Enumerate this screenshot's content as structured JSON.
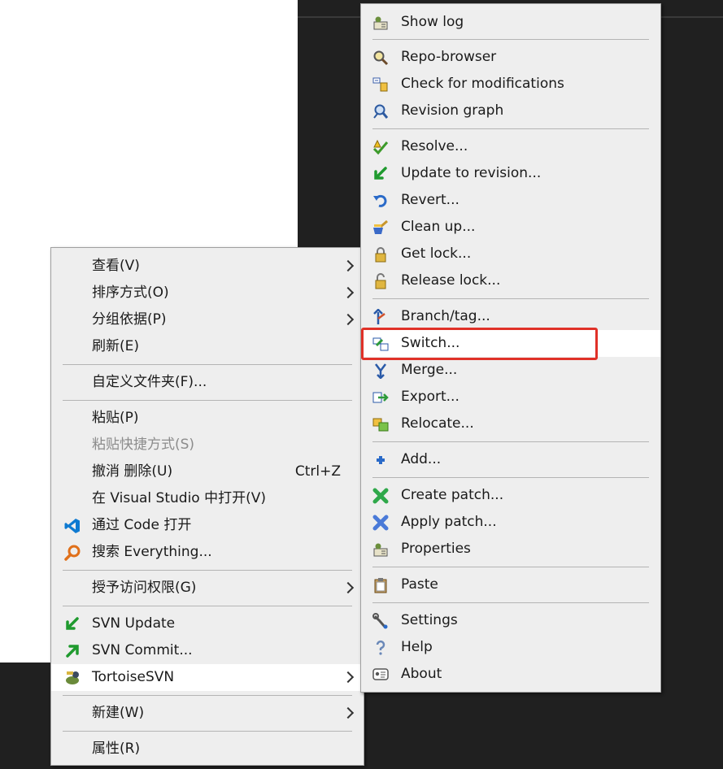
{
  "main_menu": {
    "items": [
      {
        "label": "查看(V)"
      },
      {
        "label": "排序方式(O)"
      },
      {
        "label": "分组依据(P)"
      },
      {
        "label": "刷新(E)"
      },
      {
        "label": "自定义文件夹(F)..."
      },
      {
        "label": "粘贴(P)"
      },
      {
        "label": "粘贴快捷方式(S)"
      },
      {
        "label": "撤消 删除(U)",
        "shortcut": "Ctrl+Z"
      },
      {
        "label": "在 Visual Studio 中打开(V)"
      },
      {
        "label": "通过 Code 打开",
        "icon": "vscode-icon"
      },
      {
        "label": "搜索 Everything...",
        "icon": "everything-search-icon"
      },
      {
        "label": "授予访问权限(G)"
      },
      {
        "label": "SVN Update",
        "icon": "svn-update-icon"
      },
      {
        "label": "SVN Commit...",
        "icon": "svn-commit-icon"
      },
      {
        "label": "TortoiseSVN",
        "icon": "tortoisesvn-icon"
      },
      {
        "label": "新建(W)"
      },
      {
        "label": "属性(R)"
      }
    ]
  },
  "svn_menu": {
    "items": [
      {
        "label": "Show log",
        "icon": "show-log-icon"
      },
      {
        "label": "Repo-browser",
        "icon": "repo-browser-icon"
      },
      {
        "label": "Check for modifications",
        "icon": "check-modifications-icon"
      },
      {
        "label": "Revision graph",
        "icon": "revision-graph-icon"
      },
      {
        "label": "Resolve...",
        "icon": "resolve-icon"
      },
      {
        "label": "Update to revision...",
        "icon": "update-revision-icon"
      },
      {
        "label": "Revert...",
        "icon": "revert-icon"
      },
      {
        "label": "Clean up...",
        "icon": "cleanup-icon"
      },
      {
        "label": "Get lock...",
        "icon": "lock-icon"
      },
      {
        "label": "Release lock...",
        "icon": "unlock-icon"
      },
      {
        "label": "Branch/tag...",
        "icon": "branch-tag-icon"
      },
      {
        "label": "Switch...",
        "icon": "switch-icon"
      },
      {
        "label": "Merge...",
        "icon": "merge-icon"
      },
      {
        "label": "Export...",
        "icon": "export-icon"
      },
      {
        "label": "Relocate...",
        "icon": "relocate-icon"
      },
      {
        "label": "Add...",
        "icon": "add-icon"
      },
      {
        "label": "Create patch...",
        "icon": "create-patch-icon"
      },
      {
        "label": "Apply patch...",
        "icon": "apply-patch-icon"
      },
      {
        "label": "Properties",
        "icon": "properties-icon"
      },
      {
        "label": "Paste",
        "icon": "paste-icon"
      },
      {
        "label": "Settings",
        "icon": "settings-icon"
      },
      {
        "label": "Help",
        "icon": "help-icon"
      },
      {
        "label": "About",
        "icon": "about-icon"
      }
    ]
  },
  "colors": {
    "menu_bg": "#eeeeee",
    "highlight_bg": "#ffffff",
    "annotation_border": "#e03128",
    "desktop_bg": "#202020"
  }
}
